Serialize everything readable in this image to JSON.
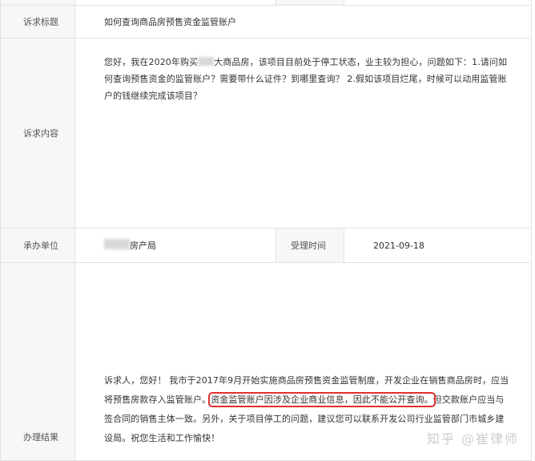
{
  "rows": {
    "title": {
      "label": "诉求标题",
      "value": "如何查询商品房预售资金监管账户"
    },
    "content": {
      "label": "诉求内容",
      "text_part1": "您好，我在2020年购买",
      "text_part2": "大商品房，该项目目前处于停工状态，业主较为担心，问题如下：1.请问如何查询预售资金的监管账户？需要带什么证件？到哪里查询？ 2.假如该项目烂尾，时候可以动用监管账户的钱继续完成该项目？"
    },
    "unit": {
      "label": "承办单位",
      "value_suffix": "房产局",
      "accept_label": "受理时间",
      "accept_value": "2021-09-18"
    },
    "result": {
      "label": "办理结果",
      "text_before": "诉求人，您好！ 我市于2017年9月开始实施商品房预售资金监管制度，开发企业在销售商品房时，应当将预售房款存入监管账户。",
      "text_highlight": "资金监管账户因涉及企业商业信息，因此不能公开查询。",
      "text_after": "但交款账户应当与签合同的销售主体一致。另外，关于项目停工的问题，建议您可以联系开发公司行业监管部门市城乡建设局。祝您生活和工作愉快！"
    }
  },
  "watermark": "知乎 @崔律师",
  "colors": {
    "label_bg": "#f7f7f7",
    "border": "#e2e2e2",
    "highlight_border": "#e03030"
  }
}
